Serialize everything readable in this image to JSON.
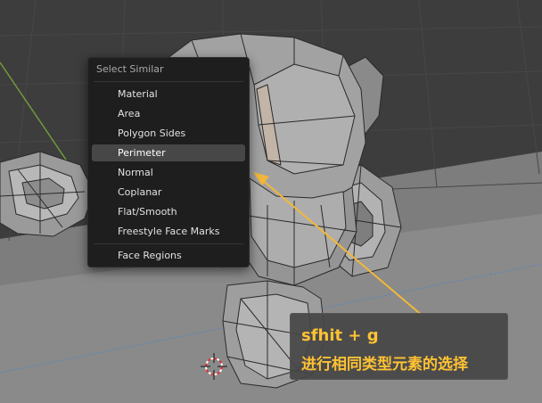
{
  "menu": {
    "title": "Select Similar",
    "items": [
      {
        "label": "Material"
      },
      {
        "label": "Area"
      },
      {
        "label": "Polygon Sides"
      },
      {
        "label": "Perimeter",
        "active": true
      },
      {
        "label": "Normal"
      },
      {
        "label": "Coplanar"
      },
      {
        "label": "Flat/Smooth"
      },
      {
        "label": "Freestyle Face Marks"
      }
    ],
    "extra_item": {
      "label": "Face Regions"
    }
  },
  "annotation": {
    "line1": "sfhit  + g",
    "line2": "进行相同类型元素的选择"
  },
  "colors": {
    "viewport_bg": "#3a3a3a",
    "menu_bg": "#1e1e1e",
    "highlight": "#474747",
    "annotation_text": "#ffc233",
    "arrow": "#f2b73a",
    "x_axis": "#5e87b6",
    "y_axis": "#6f9a3a"
  }
}
